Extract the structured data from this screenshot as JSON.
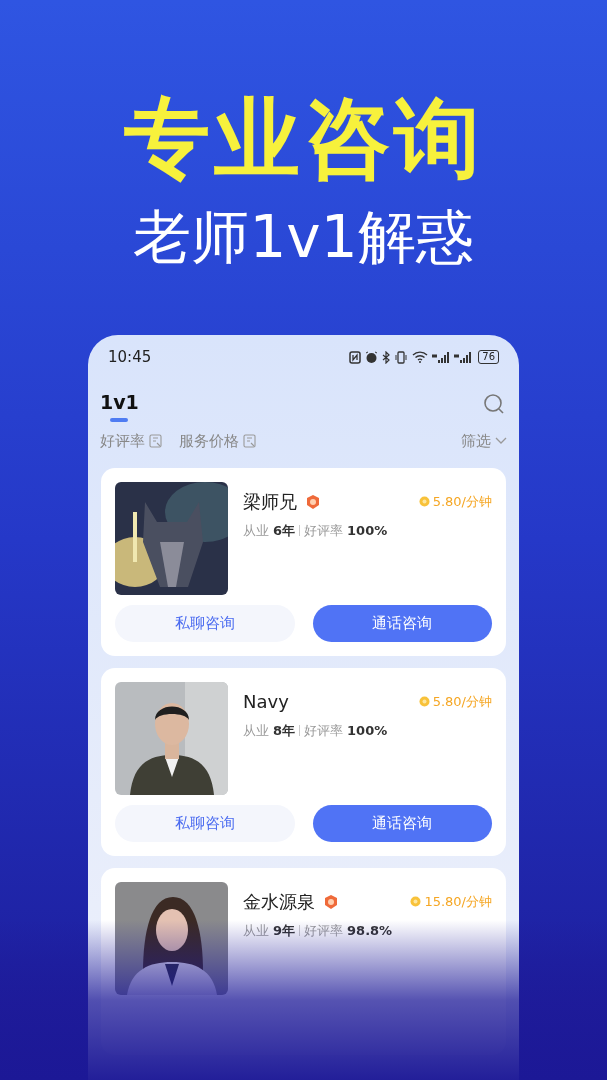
{
  "headline": "专业咨询",
  "subtitle": "老师1v1解惑",
  "phone": {
    "status_bar": {
      "time": "10:45",
      "battery": "76"
    },
    "tabs": [
      {
        "label": "1v1",
        "selected": true
      }
    ],
    "sort_options": [
      {
        "label": "好评率"
      },
      {
        "label": "服务价格"
      }
    ],
    "filter": "筛选",
    "consultants": [
      {
        "name": "梁师兄",
        "badge": true,
        "price": "5.80/分钟",
        "experience_label": "从业",
        "experience": "6年",
        "rating_label": "好评率",
        "rating": "100%",
        "buttons": [
          "私聊咨询",
          "通话咨询"
        ]
      },
      {
        "name": "Navy",
        "badge": false,
        "price": "5.80/分钟",
        "experience_label": "从业",
        "experience": "8年",
        "rating_label": "好评率",
        "rating": "100%",
        "buttons": [
          "私聊咨询",
          "通话咨询"
        ]
      },
      {
        "name": "金水源泉",
        "badge": true,
        "price": "15.80/分钟",
        "experience_label": "从业",
        "experience": "9年",
        "rating_label": "好评率",
        "rating": "98.8%"
      }
    ]
  }
}
